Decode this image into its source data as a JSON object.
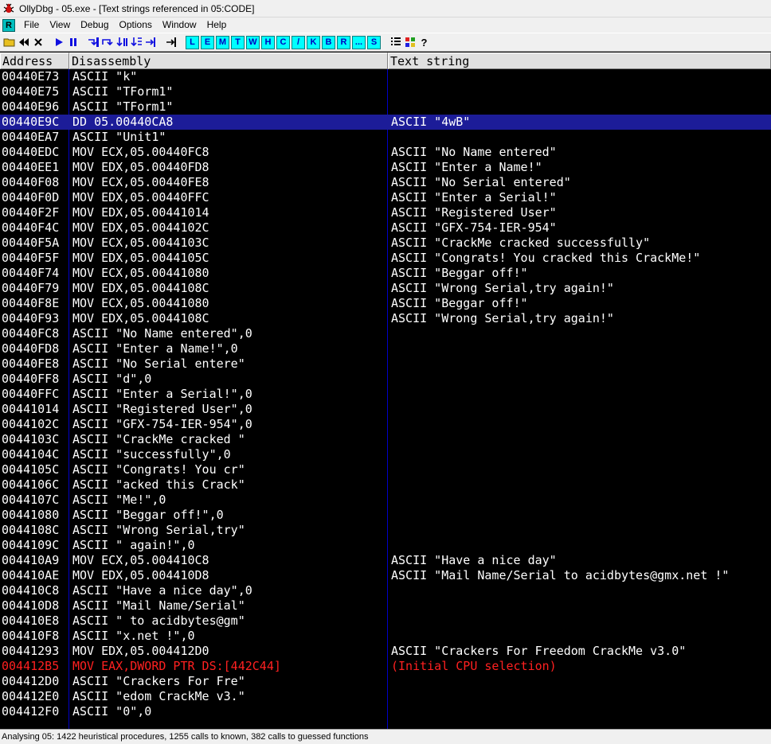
{
  "window": {
    "title": "OllyDbg - 05.exe - [Text strings referenced in 05:CODE]"
  },
  "menu": {
    "icon_letter": "R",
    "items": [
      "File",
      "View",
      "Debug",
      "Options",
      "Window",
      "Help"
    ]
  },
  "toolbar": {
    "letter_buttons": [
      "L",
      "E",
      "M",
      "T",
      "W",
      "H",
      "C",
      "/",
      "K",
      "B",
      "R",
      "...",
      "S"
    ]
  },
  "columns": {
    "address": "Address",
    "disassembly": "Disassembly",
    "text": "Text string"
  },
  "rows": [
    {
      "addr": "00440E73",
      "dis": "ASCII \"k\"",
      "text": ""
    },
    {
      "addr": "00440E75",
      "dis": "ASCII \"TForm1\"",
      "text": ""
    },
    {
      "addr": "00440E96",
      "dis": "ASCII \"TForm1\"",
      "text": ""
    },
    {
      "addr": "00440E9C",
      "dis": "DD 05.00440CA8",
      "text": "ASCII \"4wB\""
    },
    {
      "addr": "00440EA7",
      "dis": "ASCII \"Unit1\"",
      "text": ""
    },
    {
      "addr": "00440EDC",
      "dis": "MOV ECX,05.00440FC8",
      "text": "ASCII \"No Name entered\""
    },
    {
      "addr": "00440EE1",
      "dis": "MOV EDX,05.00440FD8",
      "text": "ASCII \"Enter a Name!\""
    },
    {
      "addr": "00440F08",
      "dis": "MOV ECX,05.00440FE8",
      "text": "ASCII \"No Serial entered\""
    },
    {
      "addr": "00440F0D",
      "dis": "MOV EDX,05.00440FFC",
      "text": "ASCII \"Enter a Serial!\""
    },
    {
      "addr": "00440F2F",
      "dis": "MOV EDX,05.00441014",
      "text": "ASCII \"Registered User\""
    },
    {
      "addr": "00440F4C",
      "dis": "MOV EDX,05.0044102C",
      "text": "ASCII \"GFX-754-IER-954\""
    },
    {
      "addr": "00440F5A",
      "dis": "MOV ECX,05.0044103C",
      "text": "ASCII \"CrackMe cracked successfully\""
    },
    {
      "addr": "00440F5F",
      "dis": "MOV EDX,05.0044105C",
      "text": "ASCII \"Congrats! You cracked this CrackMe!\""
    },
    {
      "addr": "00440F74",
      "dis": "MOV ECX,05.00441080",
      "text": "ASCII \"Beggar off!\""
    },
    {
      "addr": "00440F79",
      "dis": "MOV EDX,05.0044108C",
      "text": "ASCII \"Wrong Serial,try again!\""
    },
    {
      "addr": "00440F8E",
      "dis": "MOV ECX,05.00441080",
      "text": "ASCII \"Beggar off!\""
    },
    {
      "addr": "00440F93",
      "dis": "MOV EDX,05.0044108C",
      "text": "ASCII \"Wrong Serial,try again!\""
    },
    {
      "addr": "00440FC8",
      "dis": "ASCII \"No Name entered\",0",
      "text": ""
    },
    {
      "addr": "00440FD8",
      "dis": "ASCII \"Enter a Name!\",0",
      "text": ""
    },
    {
      "addr": "00440FE8",
      "dis": "ASCII \"No Serial entere\"",
      "text": ""
    },
    {
      "addr": "00440FF8",
      "dis": "ASCII \"d\",0",
      "text": ""
    },
    {
      "addr": "00440FFC",
      "dis": "ASCII \"Enter a Serial!\",0",
      "text": ""
    },
    {
      "addr": "00441014",
      "dis": "ASCII \"Registered User\",0",
      "text": ""
    },
    {
      "addr": "0044102C",
      "dis": "ASCII \"GFX-754-IER-954\",0",
      "text": ""
    },
    {
      "addr": "0044103C",
      "dis": "ASCII \"CrackMe cracked \"",
      "text": ""
    },
    {
      "addr": "0044104C",
      "dis": "ASCII \"successfully\",0",
      "text": ""
    },
    {
      "addr": "0044105C",
      "dis": "ASCII \"Congrats! You cr\"",
      "text": ""
    },
    {
      "addr": "0044106C",
      "dis": "ASCII \"acked this Crack\"",
      "text": ""
    },
    {
      "addr": "0044107C",
      "dis": "ASCII \"Me!\",0",
      "text": ""
    },
    {
      "addr": "00441080",
      "dis": "ASCII \"Beggar off!\",0",
      "text": ""
    },
    {
      "addr": "0044108C",
      "dis": "ASCII \"Wrong Serial,try\"",
      "text": ""
    },
    {
      "addr": "0044109C",
      "dis": "ASCII \" again!\",0",
      "text": ""
    },
    {
      "addr": "004410A9",
      "dis": "MOV ECX,05.004410C8",
      "text": "ASCII \"Have a nice day\""
    },
    {
      "addr": "004410AE",
      "dis": "MOV EDX,05.004410D8",
      "text": "ASCII \"Mail Name/Serial to acidbytes@gmx.net !\""
    },
    {
      "addr": "004410C8",
      "dis": "ASCII \"Have a nice day\",0",
      "text": ""
    },
    {
      "addr": "004410D8",
      "dis": "ASCII \"Mail Name/Serial\"",
      "text": ""
    },
    {
      "addr": "004410E8",
      "dis": "ASCII \" to acidbytes@gm\"",
      "text": ""
    },
    {
      "addr": "004410F8",
      "dis": "ASCII \"x.net !\",0",
      "text": ""
    },
    {
      "addr": "00441293",
      "dis": "MOV EDX,05.004412D0",
      "text": "ASCII \"Crackers For Freedom CrackMe v3.0\""
    },
    {
      "addr": "004412B5",
      "dis": "MOV EAX,DWORD PTR DS:[442C44]",
      "text": "(Initial CPU selection)"
    },
    {
      "addr": "004412D0",
      "dis": "ASCII \"Crackers For Fre\"",
      "text": ""
    },
    {
      "addr": "004412E0",
      "dis": "ASCII \"edom CrackMe v3.\"",
      "text": ""
    },
    {
      "addr": "004412F0",
      "dis": "ASCII \"0\",0",
      "text": ""
    }
  ],
  "selected_row": 3,
  "highlight_row": 39,
  "status": "Analysing 05: 1422 heuristical procedures, 1255 calls to known, 382 calls to guessed functions",
  "colors": {
    "background": "#000000",
    "text": "#ffffff",
    "selection": "#1c1c98",
    "highlight_text": "#ff2020",
    "column_line": "#0000c8"
  }
}
